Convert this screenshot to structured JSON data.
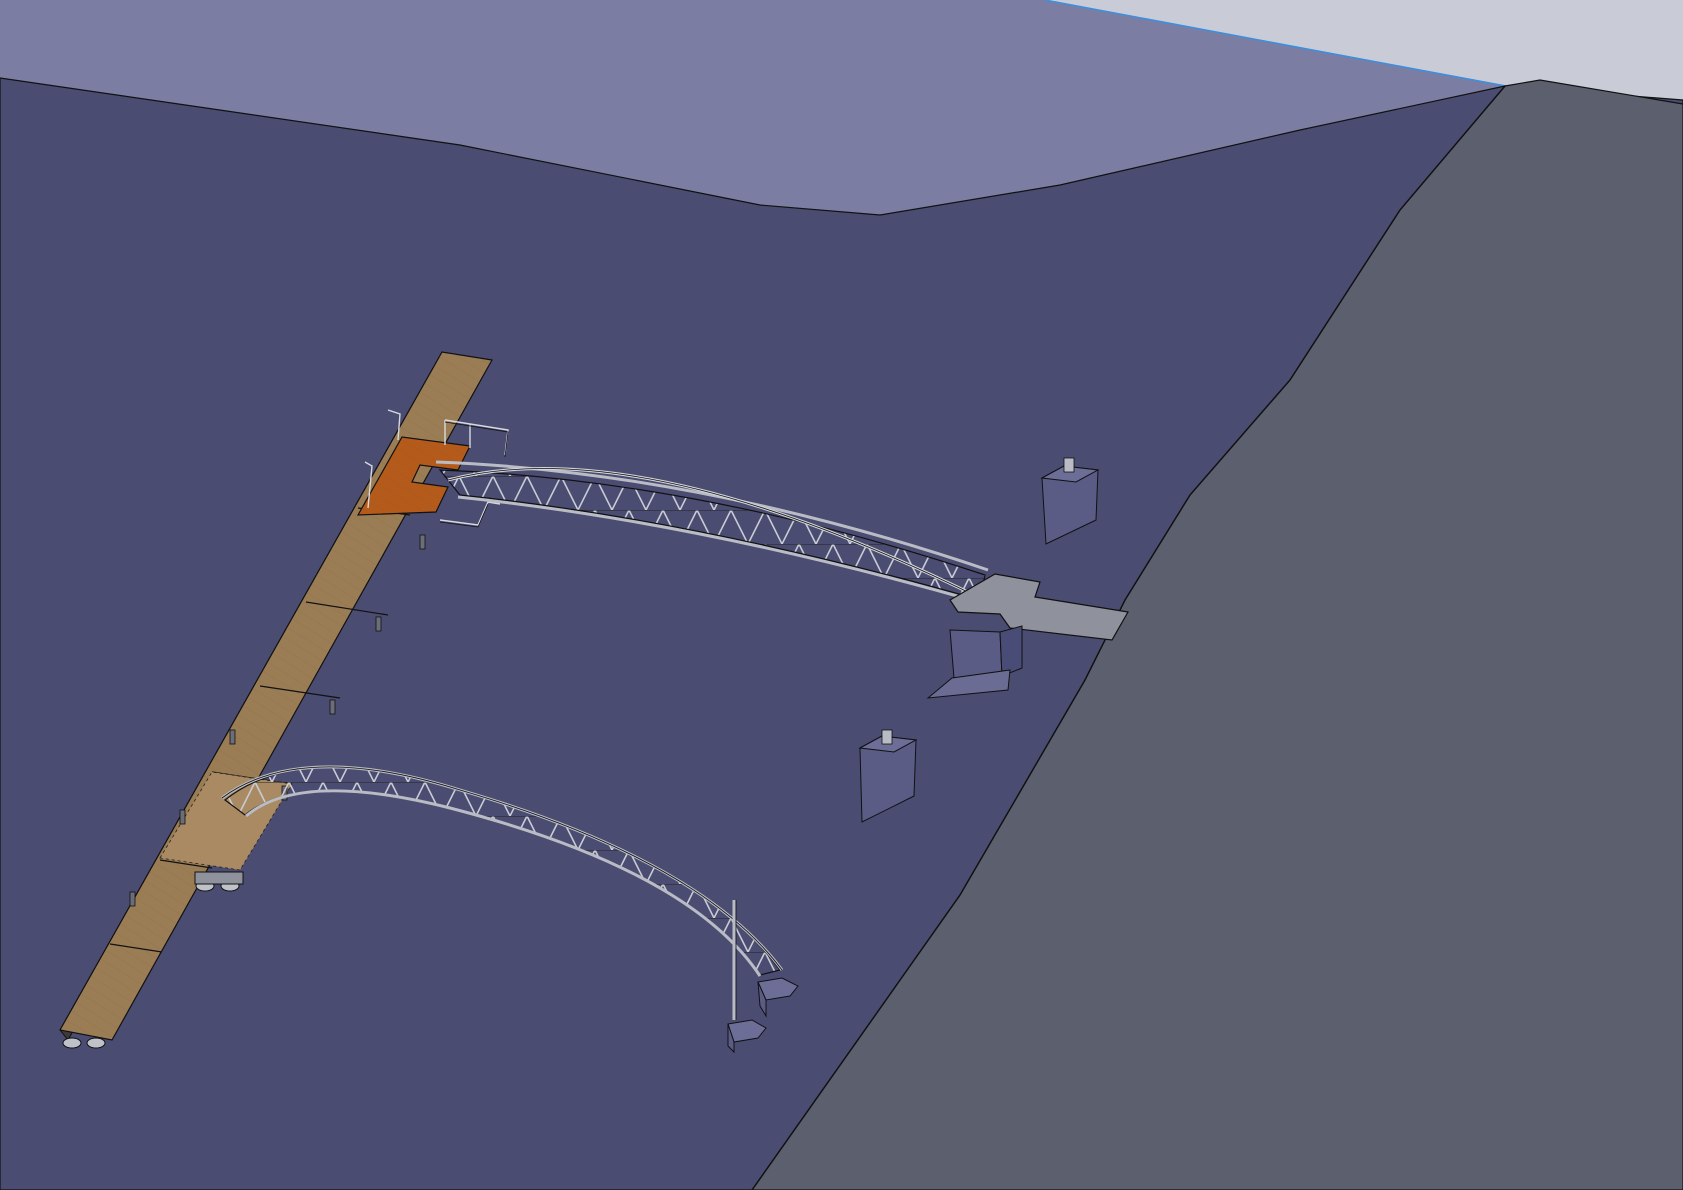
{
  "scene": {
    "description_free": true,
    "colors": {
      "sky": "#c9ccd6",
      "far_water": "#7b7ea2",
      "water": "#4b4c72",
      "embankment": "#5c5f6d",
      "dock_wood": "#8c6e48",
      "dock_wood_light": "#9b7d55",
      "platform_orange": "#b45a1a",
      "steel": "#8f929c",
      "concrete": "#5a5c86",
      "horizon_line": "#3a8fe0",
      "edge": "#111111"
    }
  }
}
